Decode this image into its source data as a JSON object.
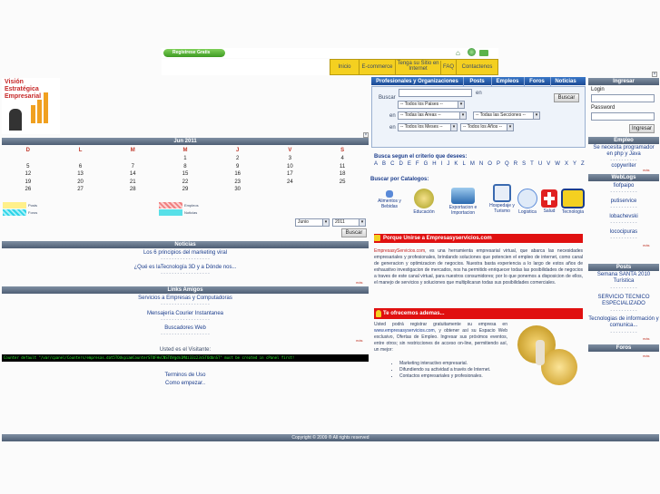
{
  "topbar": {
    "register": "Registrese Gratis",
    "nav": [
      "Inicio",
      "E-commerce",
      "Tenga su Sitio en Internet",
      "FAQ",
      "Contactenos"
    ]
  },
  "logo": {
    "line1": "Visión",
    "line2": "Estratégica",
    "line3": "Empresarial"
  },
  "calendar": {
    "title": "Jun 2011",
    "days": [
      "D",
      "L",
      "M",
      "M",
      "J",
      "V",
      "S"
    ],
    "weeks": [
      [
        "",
        "",
        "",
        "1",
        "2",
        "3",
        "4"
      ],
      [
        "5",
        "6",
        "7",
        "8",
        "9",
        "10",
        "11"
      ],
      [
        "12",
        "13",
        "14",
        "15",
        "16",
        "17",
        "18"
      ],
      [
        "19",
        "20",
        "21",
        "22",
        "23",
        "24",
        "25"
      ],
      [
        "26",
        "27",
        "28",
        "29",
        "30",
        "",
        ""
      ]
    ],
    "legend": [
      "Posts",
      "Foros",
      "Empleos",
      "Noticias"
    ],
    "month": "Junio",
    "year": "2011",
    "search": "Buscar"
  },
  "noticias": {
    "title": "Noticias",
    "items": [
      "Los 6 principios del marketing viral",
      "¿Qué es laTecnología 3D y a Dónde nos..."
    ],
    "more": "más"
  },
  "links": {
    "title": "Links Amigos",
    "items": [
      "Servicios a Empresas y Computadoras",
      "Mensajería Courier Instantanea",
      "Buscadores Web"
    ],
    "more": "más"
  },
  "visitor": {
    "label": "Usted es el Visitante:",
    "counter": "Counter default \"/var/cpanel/Counters/empresas.dat5TOdvpiamCounterSTOFHvCNSTOVgdn1Mdz33z23sSTOdbnST\" must be created in cPanel first!"
  },
  "footer_links": [
    "Terminos de Uso",
    "Como empezar.."
  ],
  "copyright": "Copyright © 2009 ® All rights reserved",
  "tabs": [
    "Profesionales y Organizaciones",
    "Posts",
    "Empleos",
    "Foros",
    "Noticias"
  ],
  "search": {
    "buscar": "Buscar",
    "en": "en",
    "en2": "en",
    "en3": "en",
    "paises": "-- Todos los Paises --",
    "areas": "-- Todas las Areas --",
    "secciones": "-- Todas las Secciones --",
    "meses": "-- Todos los Meses --",
    "anios": "-- Todos los Años --",
    "button": "Buscar"
  },
  "alpha": {
    "title": "Busca segun el criterio que desees:",
    "letters": [
      "A",
      "B",
      "C",
      "D",
      "E",
      "F",
      "G",
      "H",
      "I",
      "J",
      "K",
      "L",
      "M",
      "N",
      "O",
      "P",
      "Q",
      "R",
      "S",
      "T",
      "U",
      "V",
      "W",
      "X",
      "Y",
      "Z"
    ]
  },
  "catalogs": {
    "title": "Buscar por Catalogos:",
    "items": [
      "Alimentos y Bebidas",
      "Educación",
      "Exportacion e Importacion",
      "Hospedaje y Turismo",
      "Logistica",
      "Salud",
      "Tecnología"
    ]
  },
  "porque": {
    "title": "Porque Unirse a Empresasyservicios.com",
    "link": "EmpresasyServicios.com",
    "body": ", es una herramienta empresarial virtual, que abarca las necesidades empresariales y profesionales, brindando soluciones que potencien el empleo de internet, como canal de generacion y optimizacion de negocios. Nuestra basta experiencia a lo largo de estos años de exhaustivo investigacion de mercados, nos ha permitido enriquecer todas las posibilidades de negocios a traves de este canal virtual, para nuestros consumidores; por lo que ponemos a disposicion de ellos, el manejo de servicios y soluciones que multiplicaran todas sus posibilidades comerciales."
  },
  "ofrecemos": {
    "title": "Te ofrecemos ademas...",
    "intro": "Usted podrá registrar gratuitamente su empresa en ",
    "link": "www.empresasyservicios.com",
    "intro2": ", y obtener así su Espacio Web exclusivo, Ofertas de Empleo. Ingresar sus próximos eventos, entre otros; sin restricciones de acceso on-line, permitiendo así, un mejor:",
    "bullets": [
      "Marketing interactivo empresarial.",
      "Difundiendo su actividad a través de Internet.",
      "Contactos empresariales y profesionales."
    ]
  },
  "ingresar": {
    "title": "Ingresar",
    "login": "Login",
    "password": "Password",
    "button": "Ingresar"
  },
  "empleo": {
    "title": "Empleo",
    "items": [
      "Se necesita programador en php y Java",
      "copywriter"
    ],
    "more": "más"
  },
  "weblogs": {
    "title": "WebLogs",
    "items": [
      "fiofpaipo",
      "putiservice",
      "lobachevski",
      "lococipuras"
    ],
    "more": "más"
  },
  "posts": {
    "title": "Posts",
    "items": [
      "Semana SANTA 2010 Turística",
      "SERVICIO TECNICO ESPECIALIZADO",
      "Tecnologias de información y comunica..."
    ],
    "more": "más"
  },
  "foros": {
    "title": "Foros",
    "more": "más"
  }
}
